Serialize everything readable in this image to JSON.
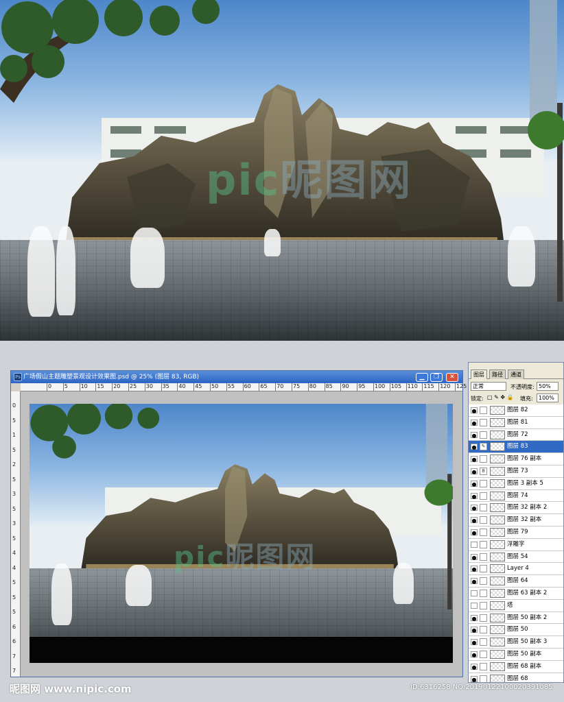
{
  "top_watermark": {
    "pic": "pic",
    "cn": "昵图网",
    "sub": "www.nipic.com"
  },
  "document": {
    "title": "广场假山主题雕塑景观设计效果图.psd @ 25% (图层 83, RGB)",
    "ps_icon": "Ps",
    "buttons": {
      "minimize": "▁",
      "restore": "❐",
      "close": "✕"
    },
    "ruler_h": [
      "0",
      "5",
      "10",
      "15",
      "20",
      "25",
      "30",
      "35",
      "40",
      "45",
      "50",
      "55",
      "60",
      "65",
      "70",
      "75",
      "80",
      "85",
      "90",
      "95",
      "100",
      "105",
      "110",
      "115",
      "120",
      "125",
      "13"
    ],
    "ruler_v": [
      "0",
      "5",
      "1",
      "5",
      "2",
      "5",
      "3",
      "5",
      "3",
      "5",
      "4",
      "4",
      "5",
      "5",
      "5",
      "6",
      "6",
      "7",
      "7"
    ]
  },
  "layers_panel": {
    "tabs": [
      "图层",
      "路径",
      "通道"
    ],
    "blend_mode": "正常",
    "opacity_label": "不透明度:",
    "opacity_value": "50%",
    "lock_label": "锁定:",
    "lock_icons": "□ ✎ ✥ 🔒",
    "fill_label": "填充:",
    "fill_value": "100%",
    "layers": [
      {
        "name": "图层 82",
        "visible": true,
        "selected": false,
        "link": ""
      },
      {
        "name": "图层 81",
        "visible": true,
        "selected": false,
        "link": ""
      },
      {
        "name": "图层 72",
        "visible": true,
        "selected": false,
        "link": ""
      },
      {
        "name": "图层 83",
        "visible": true,
        "selected": true,
        "link": "✎"
      },
      {
        "name": "图层 76 副本",
        "visible": true,
        "selected": false,
        "link": ""
      },
      {
        "name": "图层 73",
        "visible": true,
        "selected": false,
        "link": "8"
      },
      {
        "name": "图层 3 副本 5",
        "visible": true,
        "selected": false,
        "link": ""
      },
      {
        "name": "图层 74",
        "visible": true,
        "selected": false,
        "link": ""
      },
      {
        "name": "图层 32 副本 2",
        "visible": true,
        "selected": false,
        "link": ""
      },
      {
        "name": "图层 32 副本",
        "visible": true,
        "selected": false,
        "link": ""
      },
      {
        "name": "图层 79",
        "visible": true,
        "selected": false,
        "link": ""
      },
      {
        "name": "浮雕字",
        "visible": false,
        "selected": false,
        "link": ""
      },
      {
        "name": "图层 54",
        "visible": true,
        "selected": false,
        "link": ""
      },
      {
        "name": "Layer 4",
        "visible": true,
        "selected": false,
        "link": ""
      },
      {
        "name": "图层 64",
        "visible": true,
        "selected": false,
        "link": ""
      },
      {
        "name": "图层 63 副本 2",
        "visible": false,
        "selected": false,
        "link": ""
      },
      {
        "name": "塔",
        "visible": false,
        "selected": false,
        "link": ""
      },
      {
        "name": "图层 50 副本 2",
        "visible": true,
        "selected": false,
        "link": ""
      },
      {
        "name": "图层 50",
        "visible": true,
        "selected": false,
        "link": ""
      },
      {
        "name": "图层 50 副本 3",
        "visible": true,
        "selected": false,
        "link": ""
      },
      {
        "name": "图层 50 副本",
        "visible": true,
        "selected": false,
        "link": ""
      },
      {
        "name": "图层 68 副本",
        "visible": true,
        "selected": false,
        "link": ""
      },
      {
        "name": "图层 68",
        "visible": true,
        "selected": false,
        "link": ""
      }
    ]
  },
  "footer": {
    "logo": "昵图网 www.nipic.com",
    "id_text": "ID:6316258 NO:20190122100020391085"
  }
}
